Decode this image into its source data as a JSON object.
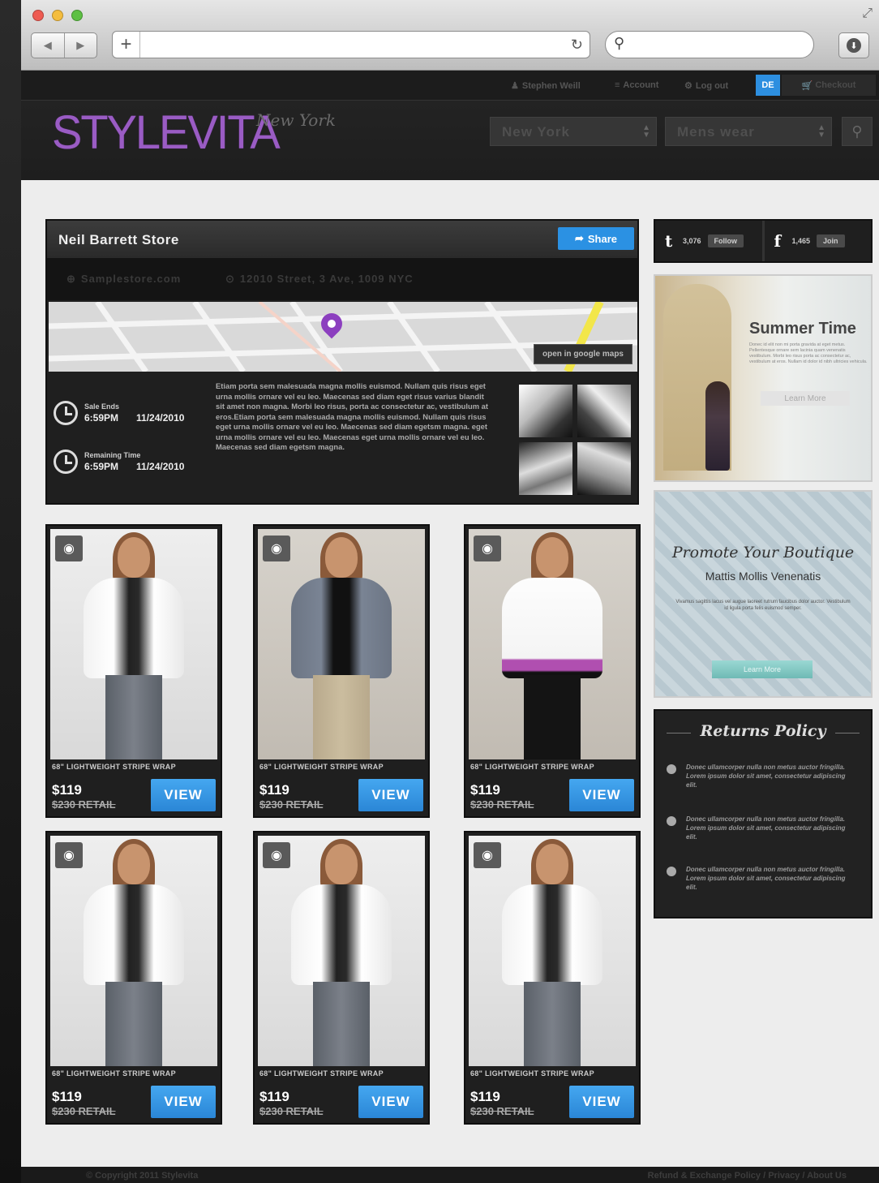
{
  "browser": {
    "back_icon": "◀",
    "forward_icon": "▶",
    "new_tab_icon": "+",
    "reload_icon": "↻",
    "search_icon": "⚲",
    "download_icon": "⬇",
    "fullscreen_icon": "⤢"
  },
  "header": {
    "user": "Stephen Weill",
    "account": "Account",
    "logout": "Log out",
    "lang": "DE",
    "cart": "Checkout",
    "logo": "STYLEVITA",
    "logo_city": "New York",
    "city_select": "New York",
    "category_select": "Mens wear",
    "search_icon": "⚲"
  },
  "store": {
    "title": "Neil Barrett Store",
    "share_label": "Share",
    "website": "Samplestore.com",
    "address": "12010 Street, 3 Ave, 1009 NYC",
    "map_button": "open in google maps",
    "sale_ends_label": "Sale Ends",
    "sale_ends_time": "6:59PM",
    "sale_ends_date": "11/24/2010",
    "remaining_label": "Remaining Time",
    "remaining_time": "6:59PM",
    "remaining_date": "11/24/2010",
    "description": "Etiam porta sem malesuada magna mollis euismod. Nullam quis risus eget urna mollis ornare vel eu leo. Maecenas sed diam eget risus varius blandit sit amet non magna. Morbi leo risus, porta ac consectetur ac, vestibulum at eros.Etiam porta sem malesuada magna mollis euismod. Nullam quis risus eget urna mollis ornare vel eu leo. Maecenas sed diam egetsm magna. eget urna mollis ornare vel eu leo. Maecenas eget urna mollis ornare vel eu leo. Maecenas sed diam egetsm magna."
  },
  "products": [
    {
      "name": "68\" LIGHTWEIGHT STRIPE WRAP",
      "price": "$119",
      "retail": "$230 RETAIL",
      "view": "VIEW"
    },
    {
      "name": "68\" LIGHTWEIGHT STRIPE WRAP",
      "price": "$119",
      "retail": "$230 RETAIL",
      "view": "VIEW"
    },
    {
      "name": "68\" LIGHTWEIGHT STRIPE WRAP",
      "price": "$119",
      "retail": "$230 RETAIL",
      "view": "VIEW"
    },
    {
      "name": "68\" LIGHTWEIGHT STRIPE WRAP",
      "price": "$119",
      "retail": "$230 RETAIL",
      "view": "VIEW"
    },
    {
      "name": "68\" LIGHTWEIGHT STRIPE WRAP",
      "price": "$119",
      "retail": "$230 RETAIL",
      "view": "VIEW"
    },
    {
      "name": "68\" LIGHTWEIGHT STRIPE WRAP",
      "price": "$119",
      "retail": "$230 RETAIL",
      "view": "VIEW"
    }
  ],
  "social": {
    "twitter_count": "3,076",
    "twitter_button": "Follow",
    "facebook_count": "1,465",
    "facebook_button": "Join"
  },
  "summer": {
    "title": "Summer Time",
    "text": "Donec id elit non mi porta gravida at eget metus. Pellentesque ornare sem lacinia quam venenatis vestibulum. Morbi leo risus porta ac consectetur ac, vestibulum at eros. Nullam id dolor id nibh ultricies vehicula.",
    "button": "Learn More"
  },
  "promo": {
    "title": "Promote Your Boutique",
    "subtitle": "Mattis Mollis Venenatis",
    "text": "Vivamus sagittis lacus vel augue laoreet rutrum faucibus dolor auctor. Vestibulum id ligula porta felis euismod semper.",
    "button": "Learn More"
  },
  "returns": {
    "title": "Returns Policy",
    "items": [
      "Donec ullamcorper nulla non metus auctor fringilla. Lorem ipsum dolor sit amet, consectetur adipiscing elit.",
      "Donec ullamcorper nulla non metus auctor fringilla. Lorem ipsum dolor sit amet, consectetur adipiscing elit.",
      "Donec ullamcorper nulla non metus auctor fringilla. Lorem ipsum dolor sit amet, consectetur adipiscing elit."
    ]
  },
  "footer": {
    "copyright": "© Copyright 2011 Stylevita",
    "links": "Refund & Exchange Policy / Privacy / About Us"
  },
  "colors": {
    "accent": "#2b91e3",
    "brand": "#9a5cc4",
    "dark": "#1f1f1f"
  }
}
